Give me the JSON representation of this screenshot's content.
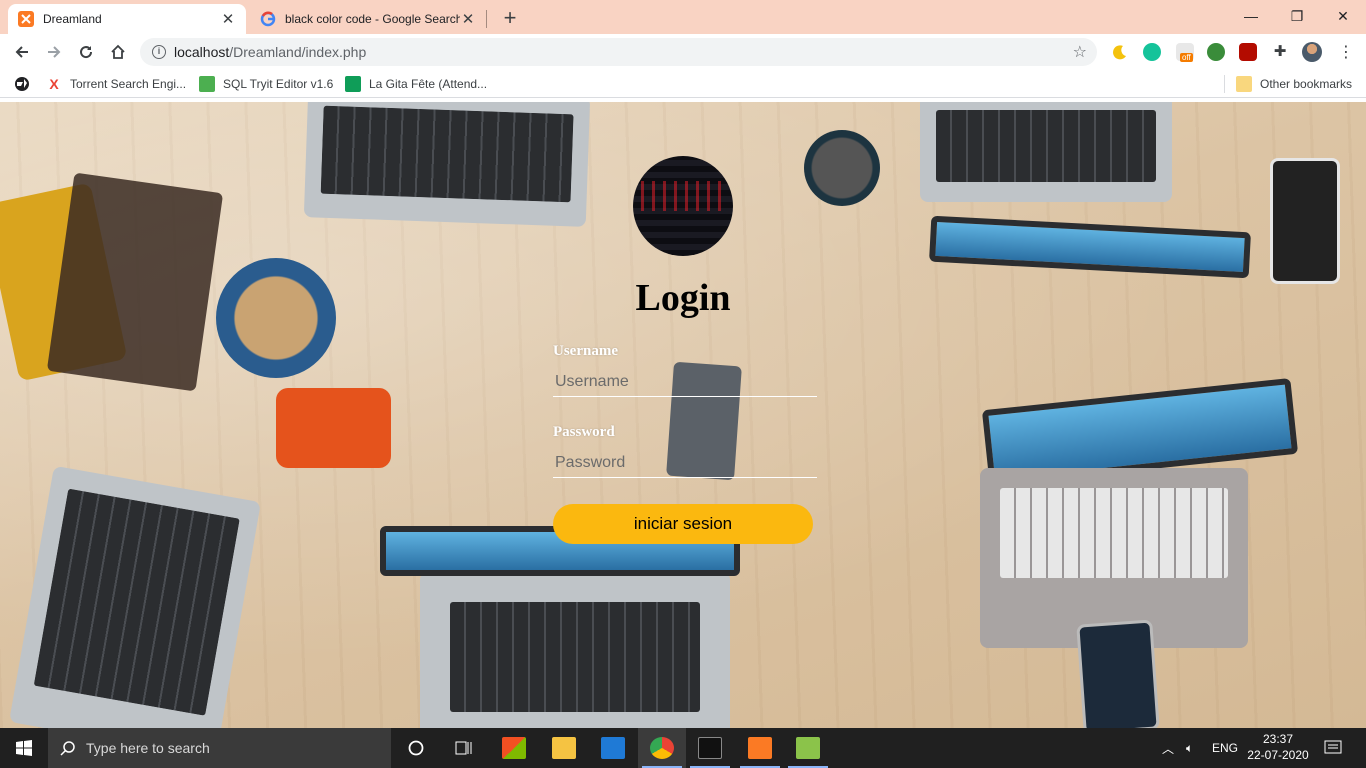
{
  "tabs": [
    {
      "title": "Dreamland",
      "favicon": "xampp-icon",
      "active": true
    },
    {
      "title": "black color code - Google Search",
      "favicon": "google-icon",
      "active": false
    }
  ],
  "address_bar": {
    "host": "localhost",
    "path": "/Dreamland/index.php"
  },
  "bookmarks": [
    {
      "label": "Torrent Search Engi...",
      "icon": "torrent-icon"
    },
    {
      "label": "SQL Tryit Editor v1.6",
      "icon": "w3schools-icon"
    },
    {
      "label": "La Gita Fête (Attend...",
      "icon": "sheets-icon"
    }
  ],
  "other_bookmarks": "Other bookmarks",
  "extension_badge": "off",
  "login": {
    "title": "Login",
    "username_label": "Username",
    "username_placeholder": "Username",
    "password_label": "Password",
    "password_placeholder": "Password",
    "submit_label": "iniciar sesion"
  },
  "taskbar": {
    "search_placeholder": "Type here to search",
    "language": "ENG",
    "time": "23:37",
    "date": "22-07-2020"
  },
  "colors": {
    "tab_strip": "#f9d3c3",
    "submit_button": "#fbb80f",
    "taskbar": "#202020"
  }
}
